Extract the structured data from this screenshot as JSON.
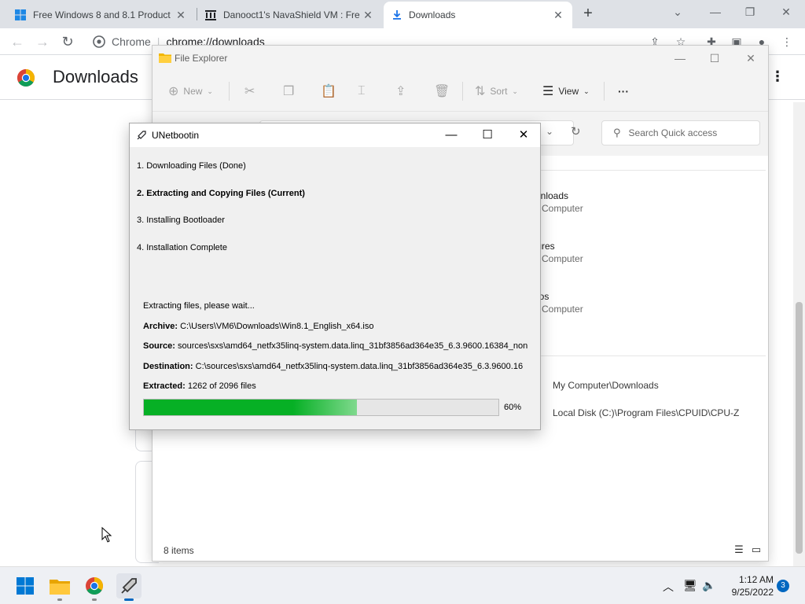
{
  "chrome": {
    "tabs": [
      {
        "title": "Free Windows 8 and 8.1 Product"
      },
      {
        "title": "Danooct1's NavaShield VM : Fre"
      },
      {
        "title": "Downloads"
      }
    ],
    "omnibox": {
      "site_chip": "Chrome",
      "url": "chrome://downloads"
    },
    "page_title": "Downloads"
  },
  "explorer": {
    "title": "File Explorer",
    "ribbon": {
      "new_label": "New",
      "sort_label": "Sort",
      "view_label": "View",
      "more_label": "···"
    },
    "search_placeholder": "Search Quick access",
    "quick_access": [
      {
        "name": "wnloads",
        "location": "Computer"
      },
      {
        "name": "tures",
        "location": "Computer"
      },
      {
        "name": "eos",
        "location": "Computer"
      }
    ],
    "recent_files": [
      {
        "path": "My Computer\\Downloads"
      },
      {
        "path": "Local Disk (C:)\\Program Files\\CPUID\\CPU-Z"
      }
    ],
    "item_count": "8 items"
  },
  "unetbootin": {
    "title": "UNetbootin",
    "steps": [
      {
        "label": "1. Downloading Files (Done)",
        "current": false
      },
      {
        "label": "2. Extracting and Copying Files (Current)",
        "current": true
      },
      {
        "label": "3. Installing Bootloader",
        "current": false
      },
      {
        "label": "4. Installation Complete",
        "current": false
      }
    ],
    "status_text": "Extracting files, please wait...",
    "archive_label": "Archive:",
    "archive_value": " C:\\Users\\VM6\\Downloads\\Win8.1_English_x64.iso",
    "source_label": "Source:",
    "source_value": " sources\\sxs\\amd64_netfx35linq-system.data.linq_31bf3856ad364e35_6.3.9600.16384_non",
    "destination_label": "Destination:",
    "destination_value": " C:\\sources\\sxs\\amd64_netfx35linq-system.data.linq_31bf3856ad364e35_6.3.9600.16",
    "extracted_label": "Extracted:",
    "extracted_value": " 1262 of 2096 files",
    "progress_fraction": 0.6,
    "progress_label": "60%"
  },
  "taskbar": {
    "clock_time": "1:12 AM",
    "clock_date": "9/25/2022",
    "notification_count": "3"
  },
  "colors": {
    "progress_green": "#06b025",
    "tab_strip": "#dee1e6",
    "taskbar": "#eef0f4",
    "accent": "#0067c0"
  }
}
